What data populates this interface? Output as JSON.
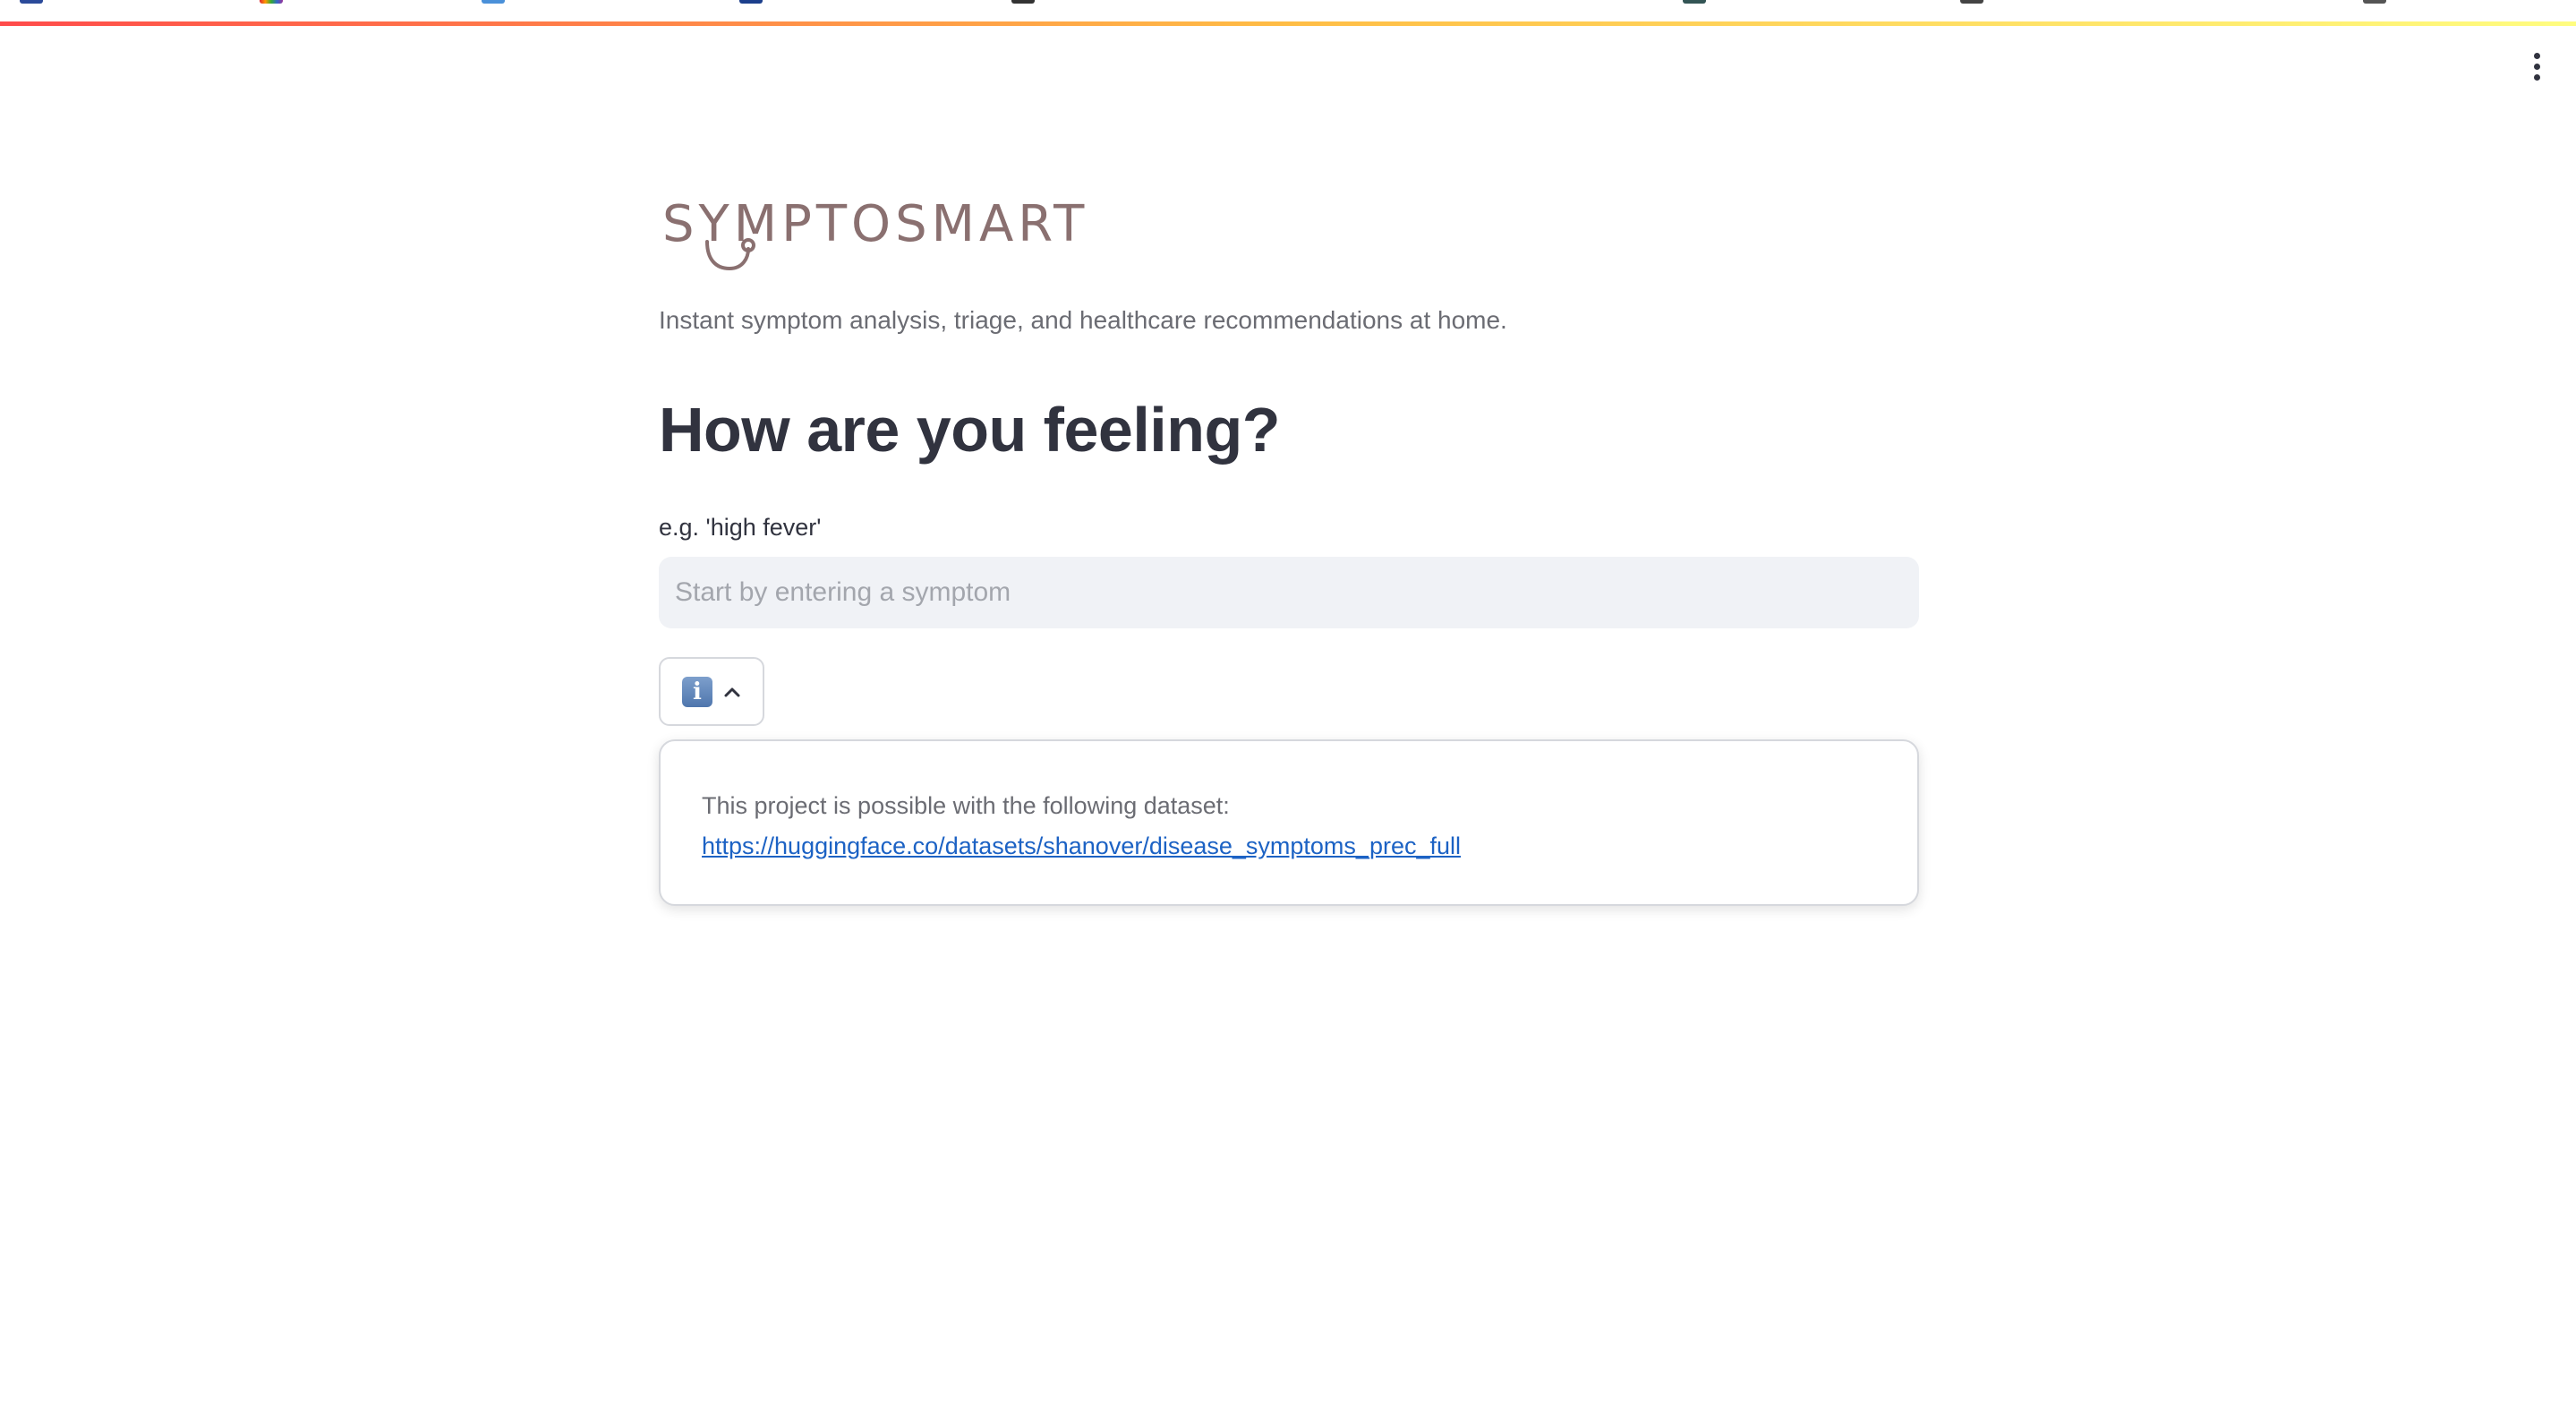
{
  "app": {
    "logo_text": "SYMPTOSMART",
    "tagline": "Instant symptom analysis, triage, and healthcare recommendations at home."
  },
  "main": {
    "heading": "How are you feeling?",
    "input_label": "e.g. 'high fever'",
    "input_placeholder": "Start by entering a symptom",
    "input_value": ""
  },
  "info": {
    "toggle_icon": "info-icon",
    "toggle_state": "expanded",
    "popover_text": "This project is possible with the following dataset:",
    "popover_link": "https://huggingface.co/datasets/shanover/disease_symptoms_prec_full"
  },
  "colors": {
    "accent_gradient": [
      "#ff4b4b",
      "#ffbd45",
      "#fffd80"
    ],
    "link": "#1c62c4",
    "heading": "#31333f",
    "input_bg": "#f0f2f6"
  },
  "icons": [
    "main-menu-icon",
    "info-icon",
    "chevron-up-icon",
    "stethoscope-icon"
  ]
}
